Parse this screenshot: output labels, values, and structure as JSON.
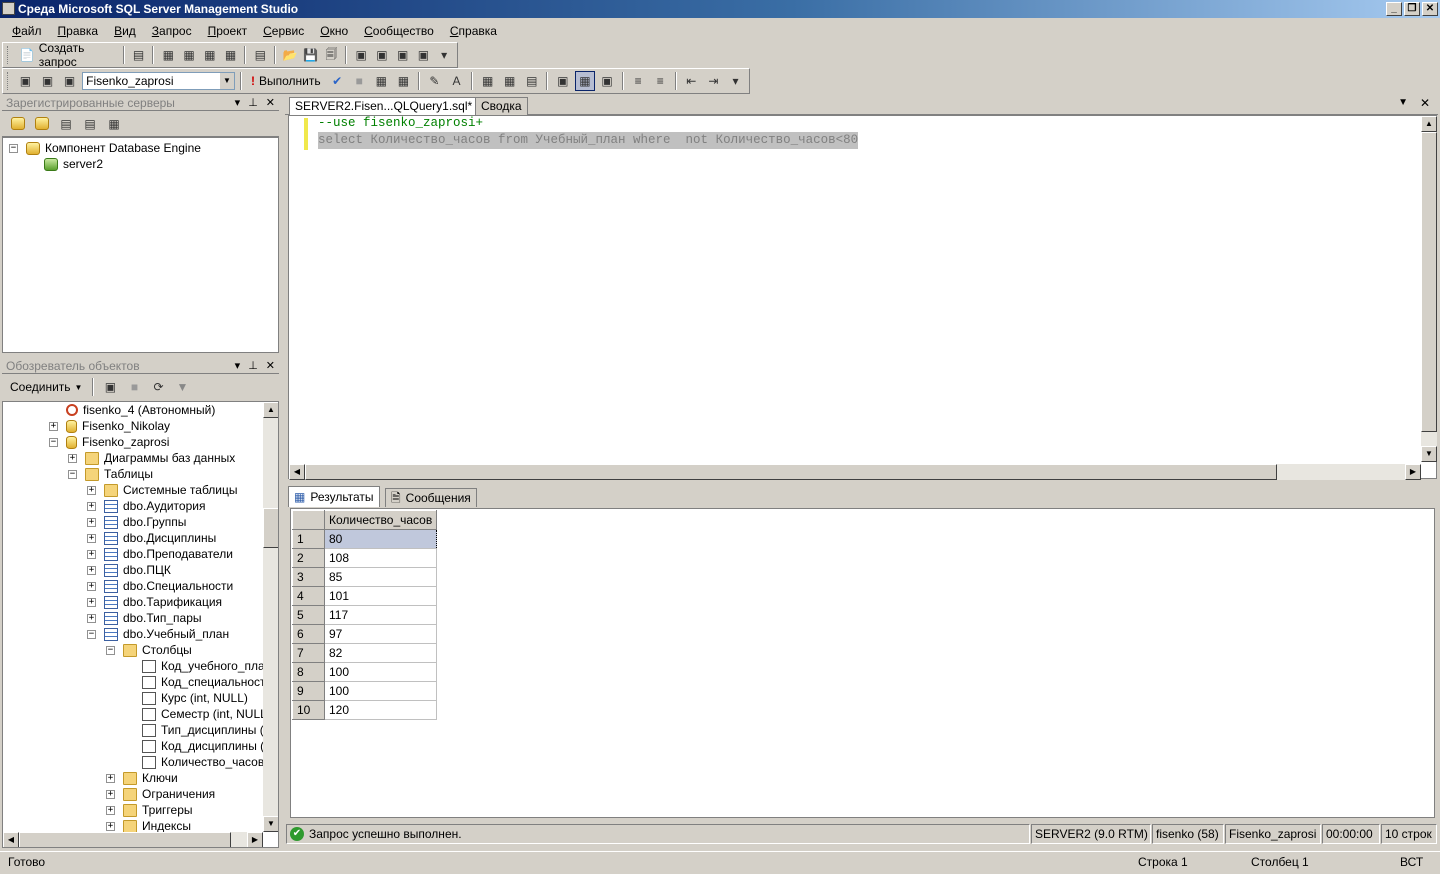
{
  "window": {
    "title": "Среда Microsoft SQL Server Management Studio"
  },
  "menu": [
    "Файл",
    "Правка",
    "Вид",
    "Запрос",
    "Проект",
    "Сервис",
    "Окно",
    "Сообщество",
    "Справка"
  ],
  "toolbar1": {
    "new_query": "Создать запрос"
  },
  "toolbar2": {
    "database": "Fisenko_zaprosi",
    "execute": "Выполнить"
  },
  "registered_servers": {
    "title": "Зарегистрированные серверы",
    "root": "Компонент Database Engine",
    "server": "server2"
  },
  "object_explorer": {
    "title": "Обозреватель объектов",
    "connect": "Соединить",
    "nodes": [
      {
        "label": "fisenko_4 (Автономный)",
        "level": 0,
        "exp": "",
        "icon": "dbwarn"
      },
      {
        "label": "Fisenko_Nikolay",
        "level": 0,
        "exp": "+",
        "icon": "db"
      },
      {
        "label": "Fisenko_zaprosi",
        "level": 0,
        "exp": "-",
        "icon": "db"
      },
      {
        "label": "Диаграммы баз данных",
        "level": 1,
        "exp": "+",
        "icon": "folder"
      },
      {
        "label": "Таблицы",
        "level": 1,
        "exp": "-",
        "icon": "folder"
      },
      {
        "label": "Системные таблицы",
        "level": 2,
        "exp": "+",
        "icon": "folder"
      },
      {
        "label": "dbo.Аудитория",
        "level": 2,
        "exp": "+",
        "icon": "table"
      },
      {
        "label": "dbo.Группы",
        "level": 2,
        "exp": "+",
        "icon": "table"
      },
      {
        "label": "dbo.Дисциплины",
        "level": 2,
        "exp": "+",
        "icon": "table"
      },
      {
        "label": "dbo.Преподаватели",
        "level": 2,
        "exp": "+",
        "icon": "table"
      },
      {
        "label": "dbo.ПЦК",
        "level": 2,
        "exp": "+",
        "icon": "table"
      },
      {
        "label": "dbo.Специальности",
        "level": 2,
        "exp": "+",
        "icon": "table"
      },
      {
        "label": "dbo.Тарификация",
        "level": 2,
        "exp": "+",
        "icon": "table"
      },
      {
        "label": "dbo.Тип_пары",
        "level": 2,
        "exp": "+",
        "icon": "table"
      },
      {
        "label": "dbo.Учебный_план",
        "level": 2,
        "exp": "-",
        "icon": "table"
      },
      {
        "label": "Столбцы",
        "level": 3,
        "exp": "-",
        "icon": "folder"
      },
      {
        "label": "Код_учебного_план",
        "level": 4,
        "exp": "",
        "icon": "column"
      },
      {
        "label": "Код_специальности",
        "level": 4,
        "exp": "",
        "icon": "column"
      },
      {
        "label": "Курс (int, NULL)",
        "level": 4,
        "exp": "",
        "icon": "column"
      },
      {
        "label": "Семестр (int, NULL)",
        "level": 4,
        "exp": "",
        "icon": "column"
      },
      {
        "label": "Тип_дисциплины (va",
        "level": 4,
        "exp": "",
        "icon": "column"
      },
      {
        "label": "Код_дисциплины (in",
        "level": 4,
        "exp": "",
        "icon": "column"
      },
      {
        "label": "Количество_часов (i",
        "level": 4,
        "exp": "",
        "icon": "column"
      },
      {
        "label": "Ключи",
        "level": 3,
        "exp": "+",
        "icon": "folder"
      },
      {
        "label": "Ограничения",
        "level": 3,
        "exp": "+",
        "icon": "folder"
      },
      {
        "label": "Триггеры",
        "level": 3,
        "exp": "+",
        "icon": "folder"
      },
      {
        "label": "Индексы",
        "level": 3,
        "exp": "+",
        "icon": "folder"
      }
    ]
  },
  "tabs": {
    "query": "SERVER2.Fisen...QLQuery1.sql*",
    "summary": "Сводка"
  },
  "editor": {
    "line1": "--use fisenko_zaprosi+",
    "line2": "select Количество_часов from Учебный_план where  not Количество_часов<80"
  },
  "results": {
    "tab_results": "Результаты",
    "tab_messages": "Сообщения",
    "column": "Количество_часов",
    "rows": [
      {
        "n": "1",
        "v": "80"
      },
      {
        "n": "2",
        "v": "108"
      },
      {
        "n": "3",
        "v": "85"
      },
      {
        "n": "4",
        "v": "101"
      },
      {
        "n": "5",
        "v": "117"
      },
      {
        "n": "6",
        "v": "97"
      },
      {
        "n": "7",
        "v": "82"
      },
      {
        "n": "8",
        "v": "100"
      },
      {
        "n": "9",
        "v": "100"
      },
      {
        "n": "10",
        "v": "120"
      }
    ]
  },
  "query_status": {
    "message": "Запрос успешно выполнен.",
    "server": "SERVER2 (9.0 RTM)",
    "user": "fisenko (58)",
    "database": "Fisenko_zaprosi",
    "time": "00:00:00",
    "rows": "10 строк"
  },
  "statusbar": {
    "ready": "Готово",
    "line": "Строка 1",
    "col": "Столбец 1",
    "mode": "ВСТ"
  }
}
